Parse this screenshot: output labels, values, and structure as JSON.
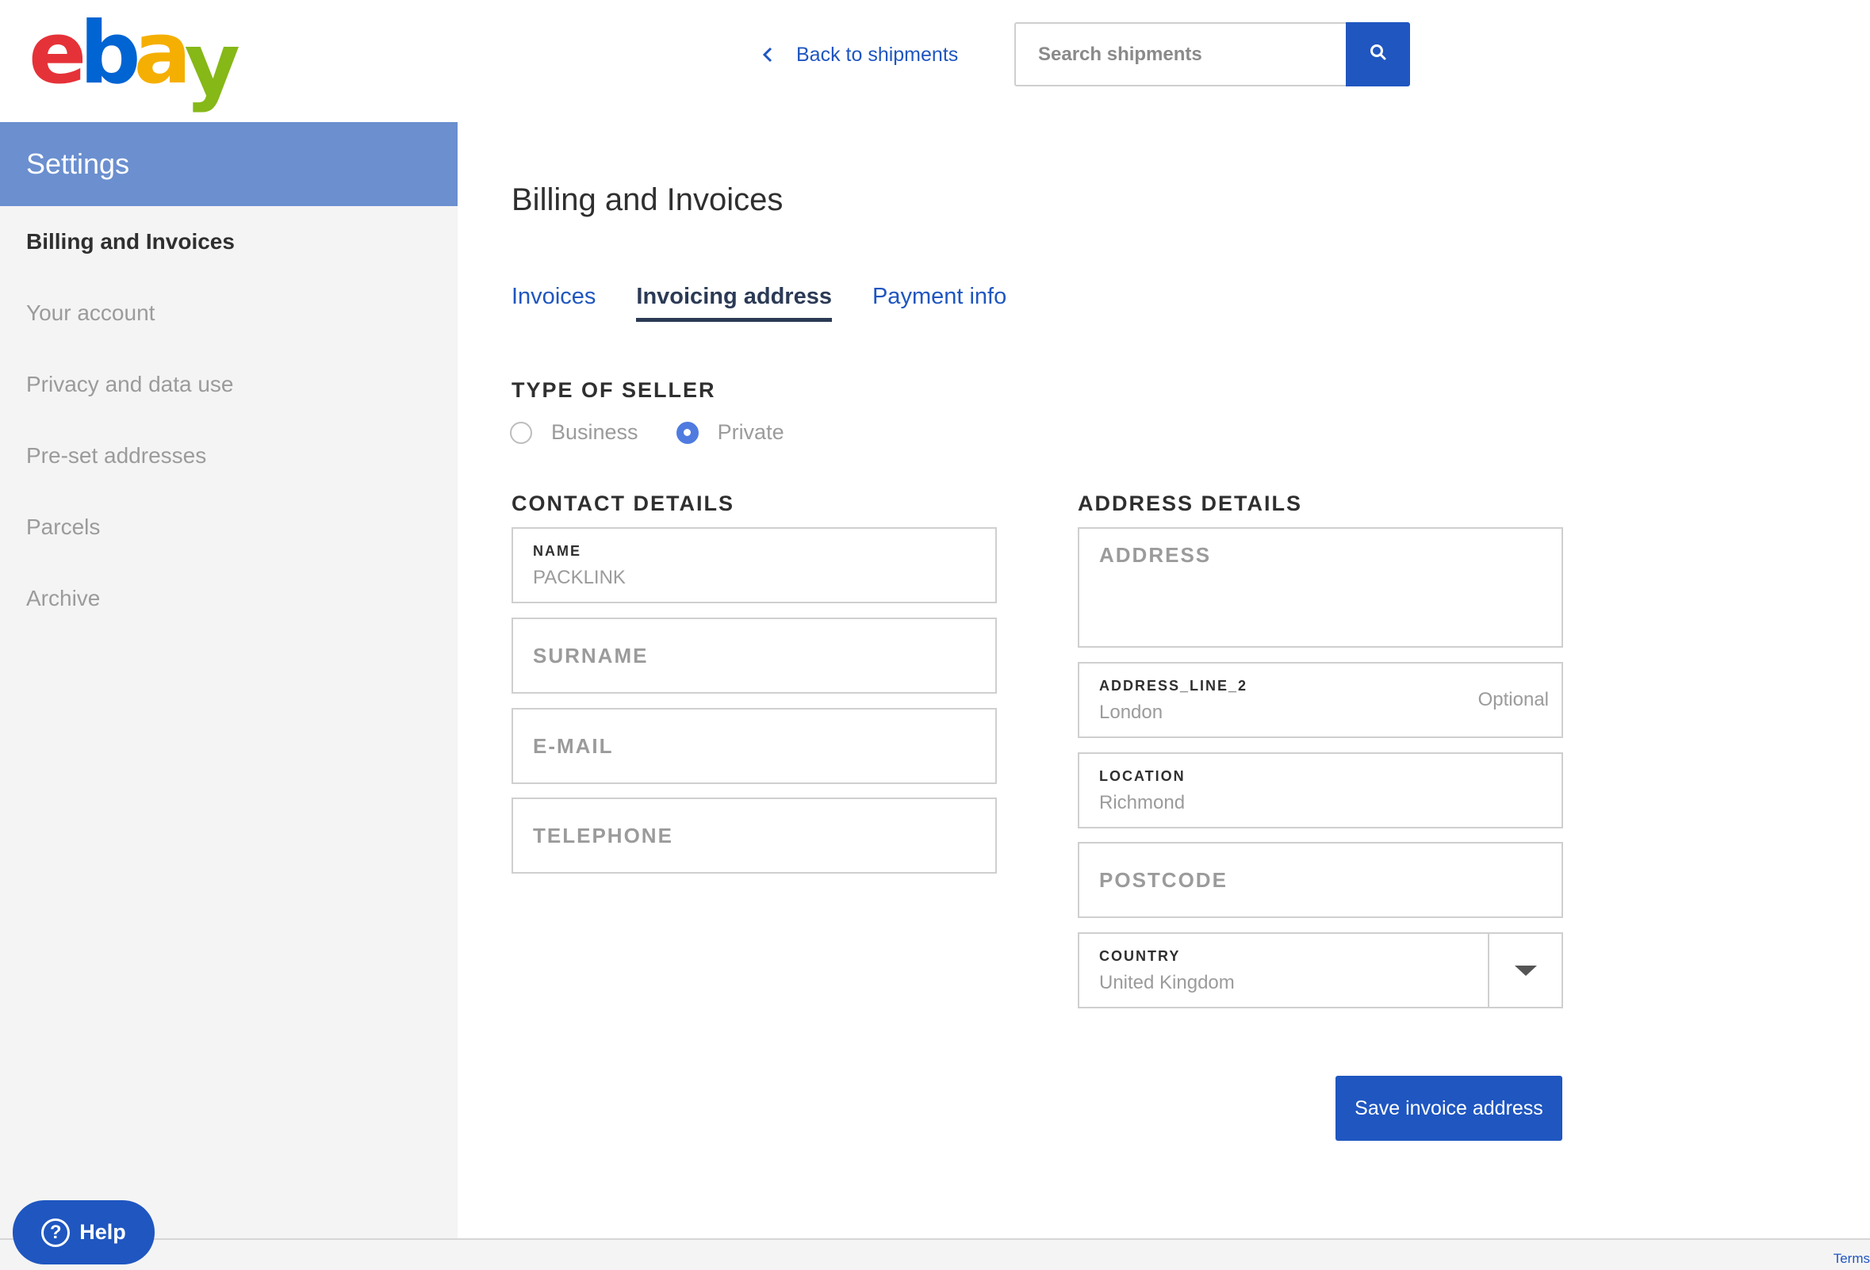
{
  "brand": {
    "logo_letters": [
      {
        "char": "e",
        "color": "#e53238"
      },
      {
        "char": "b",
        "color": "#0064d2"
      },
      {
        "char": "a",
        "color": "#f5af02"
      },
      {
        "char": "y",
        "color": "#86b817"
      }
    ]
  },
  "header": {
    "back_label": "Back to shipments",
    "back_icon": "chevron-left-icon",
    "search_placeholder": "Search shipments",
    "search_icon": "search-icon"
  },
  "sidebar": {
    "title": "Settings",
    "items": [
      {
        "label": "Billing and Invoices",
        "active": true
      },
      {
        "label": "Your account",
        "active": false
      },
      {
        "label": "Privacy and data use",
        "active": false
      },
      {
        "label": "Pre-set addresses",
        "active": false
      },
      {
        "label": "Parcels",
        "active": false
      },
      {
        "label": "Archive",
        "active": false
      }
    ]
  },
  "help": {
    "label": "Help",
    "icon": "question-circle-icon"
  },
  "main": {
    "title": "Billing and Invoices",
    "tabs": [
      {
        "label": "Invoices",
        "active": false
      },
      {
        "label": "Invoicing address",
        "active": true
      },
      {
        "label": "Payment info",
        "active": false
      }
    ],
    "seller_type": {
      "heading": "TYPE OF SELLER",
      "options": [
        {
          "label": "Business",
          "checked": false
        },
        {
          "label": "Private",
          "checked": true
        }
      ]
    },
    "contact": {
      "heading": "CONTACT DETAILS",
      "name_label": "NAME",
      "name_value": "PACKLINK",
      "surname_placeholder": "SURNAME",
      "email_placeholder": "E-MAIL",
      "telephone_placeholder": "TELEPHONE"
    },
    "address": {
      "heading": "ADDRESS DETAILS",
      "address_placeholder": "ADDRESS",
      "line2_label": "ADDRESS_LINE_2",
      "line2_value": "London",
      "line2_optional": "Optional",
      "location_label": "LOCATION",
      "location_value": "Richmond",
      "postcode_placeholder": "POSTCODE",
      "country_label": "COUNTRY",
      "country_value": "United Kingdom"
    },
    "save_label": "Save invoice address"
  },
  "footer": {
    "terms_label": "Terms"
  },
  "colors": {
    "accent": "#1f56c0",
    "sidebar_header": "#6b8fcf",
    "radio_checked": "#4f7be0"
  }
}
